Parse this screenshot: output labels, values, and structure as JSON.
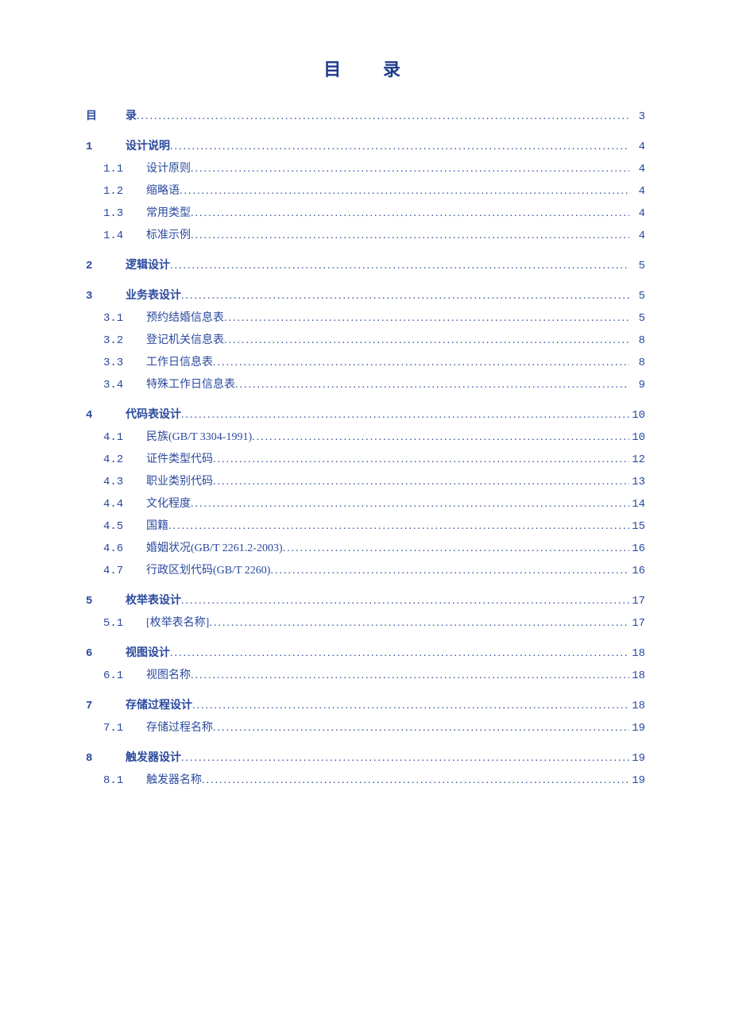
{
  "title_a": "目",
  "title_b": "录",
  "toc": [
    {
      "num": "目",
      "label": "录",
      "page": "3",
      "level": 1,
      "ml": true
    },
    {
      "num": "1",
      "label": "设计说明",
      "page": "4",
      "level": 1
    },
    {
      "num": "1.1",
      "label": "设计原则",
      "page": "4",
      "level": 2
    },
    {
      "num": "1.2",
      "label": "缩略语",
      "page": "4",
      "level": 2
    },
    {
      "num": "1.3",
      "label": "常用类型",
      "page": "4",
      "level": 2
    },
    {
      "num": "1.4",
      "label": "标准示例",
      "page": "4",
      "level": 2
    },
    {
      "num": "2",
      "label": "逻辑设计",
      "page": "5",
      "level": 1
    },
    {
      "num": "3",
      "label": "业务表设计",
      "page": "5",
      "level": 1
    },
    {
      "num": "3.1",
      "label": "预约结婚信息表",
      "page": "5",
      "level": 2
    },
    {
      "num": "3.2",
      "label": "登记机关信息表",
      "page": "8",
      "level": 2
    },
    {
      "num": "3.3",
      "label": "工作日信息表",
      "page": "8",
      "level": 2
    },
    {
      "num": "3.4",
      "label": "特殊工作日信息表",
      "page": "9",
      "level": 2
    },
    {
      "num": "4",
      "label": "代码表设计",
      "page": "10",
      "level": 1
    },
    {
      "num": "4.1",
      "label": "民族(GB/T 3304-1991)",
      "page": "10",
      "level": 2
    },
    {
      "num": "4.2",
      "label": "证件类型代码",
      "page": "12",
      "level": 2
    },
    {
      "num": "4.3",
      "label": "职业类别代码",
      "page": "13",
      "level": 2
    },
    {
      "num": "4.4",
      "label": "文化程度",
      "page": "14",
      "level": 2
    },
    {
      "num": "4.5",
      "label": "国籍",
      "page": "15",
      "level": 2
    },
    {
      "num": "4.6",
      "label": "婚姻状况(GB/T 2261.2-2003)",
      "page": "16",
      "level": 2
    },
    {
      "num": "4.7",
      "label": "行政区划代码(GB/T 2260)",
      "page": "16",
      "level": 2
    },
    {
      "num": "5",
      "label": "枚举表设计",
      "page": "17",
      "level": 1
    },
    {
      "num": "5.1",
      "label": "[枚举表名称]",
      "page": "17",
      "level": 2
    },
    {
      "num": "6",
      "label": "视图设计",
      "page": "18",
      "level": 1
    },
    {
      "num": "6.1",
      "label": "视图名称",
      "page": "18",
      "level": 2
    },
    {
      "num": "7",
      "label": "存储过程设计",
      "page": "18",
      "level": 1
    },
    {
      "num": "7.1",
      "label": "存储过程名称",
      "page": "19",
      "level": 2
    },
    {
      "num": "8",
      "label": "触发器设计",
      "page": "19",
      "level": 1
    },
    {
      "num": "8.1",
      "label": "触发器名称",
      "page": "19",
      "level": 2
    }
  ]
}
